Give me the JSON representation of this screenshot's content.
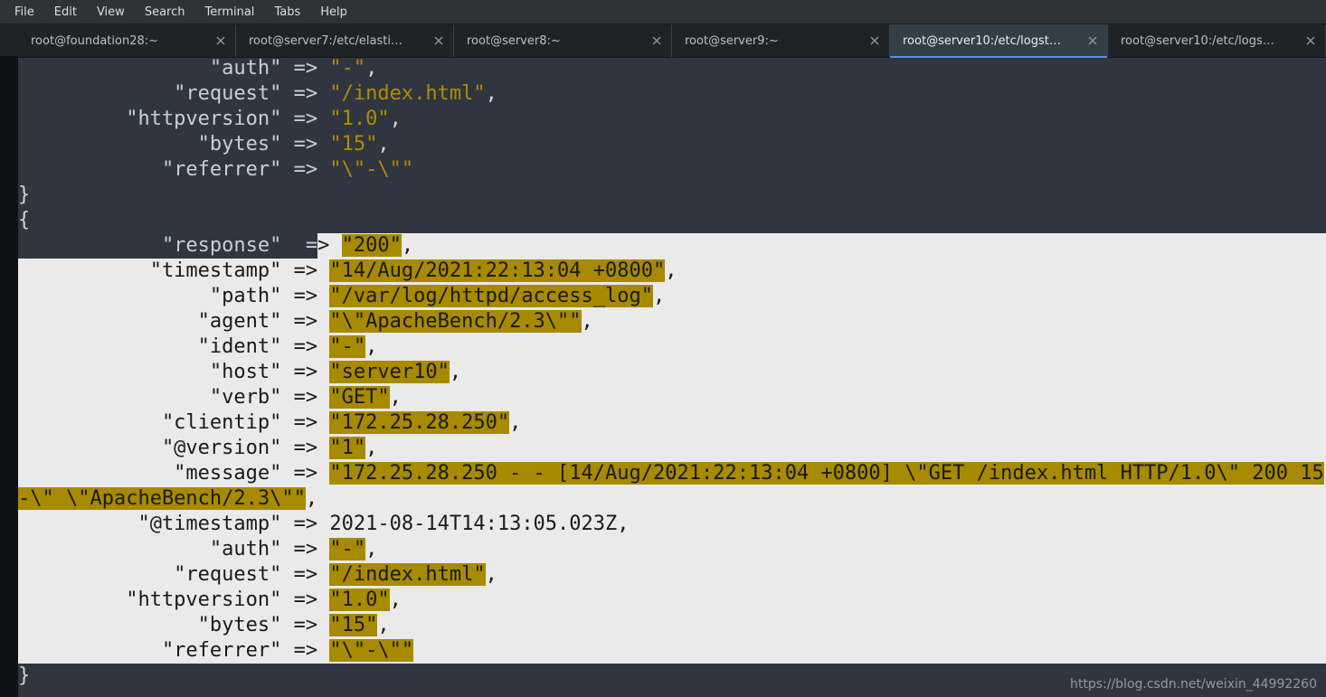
{
  "menubar": {
    "items": [
      "File",
      "Edit",
      "View",
      "Search",
      "Terminal",
      "Tabs",
      "Help"
    ]
  },
  "tabs": [
    {
      "label": "root@foundation28:~",
      "active": false
    },
    {
      "label": "root@server7:/etc/elasti…",
      "active": false
    },
    {
      "label": "root@server8:~",
      "active": false
    },
    {
      "label": "root@server9:~",
      "active": false
    },
    {
      "label": "root@server10:/etc/logst…",
      "active": true
    },
    {
      "label": "root@server10:/etc/logs…",
      "active": false
    }
  ],
  "terminal": {
    "pad": "           ",
    "block_top": [
      {
        "key": "\"auth\"",
        "val": "\"-\"",
        "trail": ","
      },
      {
        "key": "\"request\"",
        "val": "\"/index.html\"",
        "trail": ","
      },
      {
        "key": "\"httpversion\"",
        "val": "\"1.0\"",
        "trail": ","
      },
      {
        "key": "\"bytes\"",
        "val": "\"15\"",
        "trail": ","
      },
      {
        "key": "\"referrer\"",
        "val": "\"\\\"-\\\"\"",
        "trail": ""
      }
    ],
    "close_brace": "}",
    "open_brace": "{",
    "split_row": {
      "key": "\"response\"",
      "arrow_left": " =",
      "arrow_right": "> ",
      "val": "\"200\"",
      "trail": ","
    },
    "sel_rows": [
      {
        "key": "\"timestamp\"",
        "val": "\"14/Aug/2021:22:13:04 +0800\"",
        "trail": ","
      },
      {
        "key": "\"path\"",
        "val": "\"/var/log/httpd/access_log\"",
        "trail": ","
      },
      {
        "key": "\"agent\"",
        "val": "\"\\\"ApacheBench/2.3\\\"\"",
        "trail": ","
      },
      {
        "key": "\"ident\"",
        "val": "\"-\"",
        "trail": ","
      },
      {
        "key": "\"host\"",
        "val": "\"server10\"",
        "trail": ","
      },
      {
        "key": "\"verb\"",
        "val": "\"GET\"",
        "trail": ","
      },
      {
        "key": "\"clientip\"",
        "val": "\"172.25.28.250\"",
        "trail": ","
      },
      {
        "key": "\"@version\"",
        "val": "\"1\"",
        "trail": ","
      }
    ],
    "message_row": {
      "key": "\"message\"",
      "val_line1": "\"172.25.28.250 - - [14/Aug/2021:22:13:04 +0800] \\\"GET /index.html HTTP/1.0\\\" 200 15",
      "val_line2": "-\\\" \\\"ApacheBench/2.3\\\"\"",
      "trail": ","
    },
    "ts_row": {
      "key": "\"@timestamp\"",
      "val_plain": "2021-08-14T14:13:05.023Z,",
      "trail": ""
    },
    "sel_rows2": [
      {
        "key": "\"auth\"",
        "val": "\"-\"",
        "trail": ","
      },
      {
        "key": "\"request\"",
        "val": "\"/index.html\"",
        "trail": ","
      },
      {
        "key": "\"httpversion\"",
        "val": "\"1.0\"",
        "trail": ","
      },
      {
        "key": "\"bytes\"",
        "val": "\"15\"",
        "trail": ","
      },
      {
        "key": "\"referrer\"",
        "val": "\"\\\"-\\\"\"",
        "trail": ""
      }
    ],
    "final_brace": "}"
  },
  "watermark": "https://blog.csdn.net/weixin_44992260"
}
